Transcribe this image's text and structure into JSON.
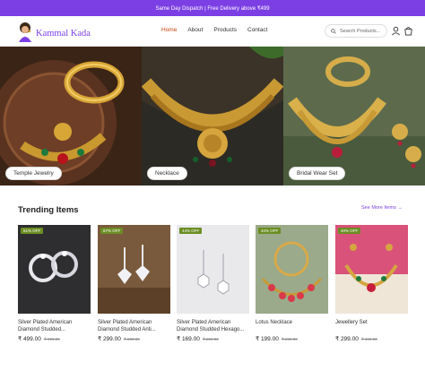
{
  "announcement": "Same Day Dispatch | Free Delivery above ₹499",
  "brand": {
    "name": "Kammal Kada"
  },
  "nav": [
    {
      "label": "Home",
      "active": true
    },
    {
      "label": "About",
      "active": false
    },
    {
      "label": "Products",
      "active": false
    },
    {
      "label": "Contact",
      "active": false
    }
  ],
  "search": {
    "placeholder": "Search Products..."
  },
  "hero": [
    {
      "label": "Temple Jewelry"
    },
    {
      "label": "Necklace"
    },
    {
      "label": "Bridal Wear Set"
    }
  ],
  "trending": {
    "title": "Trending Items",
    "see_more": "See More Items →",
    "products": [
      {
        "badge": "51% OFF",
        "name": "Silver Plated American Diamond Studded...",
        "price": "₹ 499.00",
        "old_price": "₹ 999.00"
      },
      {
        "badge": "67% OFF",
        "name": "Silver Plated American Diamond Studded Anti...",
        "price": "₹ 299.00",
        "old_price": "₹ 899.00"
      },
      {
        "badge": "44% OFF",
        "name": "Silver Plated American Diamond Studded Hexago...",
        "price": "₹ 169.00",
        "old_price": "₹ 299.00"
      },
      {
        "badge": "34% OFF",
        "name": "Lotus Necklace",
        "price": "₹ 199.00",
        "old_price": "₹ 299.00"
      },
      {
        "badge": "40% OFF",
        "name": "Jewellery Set",
        "price": "₹ 299.00",
        "old_price": "₹ 499.00"
      }
    ]
  },
  "colors": {
    "accent": "#7b3fe4",
    "nav_active": "#c2410c",
    "badge": "#6b8e23"
  }
}
